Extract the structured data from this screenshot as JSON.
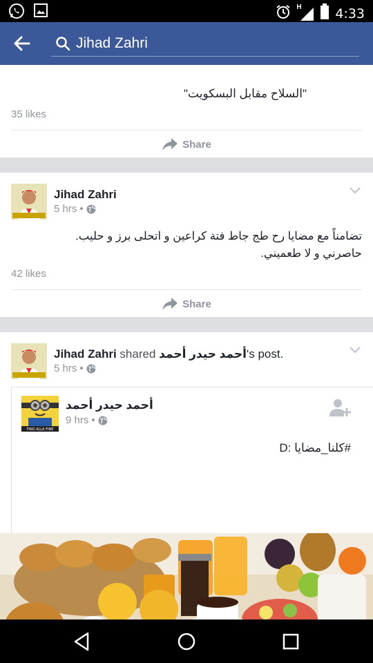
{
  "status_bar": {
    "time": "4:33",
    "network_label": "H"
  },
  "search": {
    "query": "Jihad Zahri"
  },
  "posts": [
    {
      "text_fragment": "السلاح مقابل البسكويت",
      "likes": "35 likes",
      "share_label": "Share"
    },
    {
      "author": "Jihad Zahri",
      "time": "5 hrs",
      "separator": "•",
      "body_line1": "تضامناً مع مضايا رح طج جاط فتة كراعين و اتحلى برز و حليب.",
      "body_line2": "حاصرني و لا طعميني.",
      "likes": "42 likes",
      "share_label": "Share"
    },
    {
      "author": "Jihad Zahri",
      "shared_word": "shared",
      "shared_name": "أحمد حيدر أحمد",
      "post_suffix": "'s post.",
      "time": "5 hrs",
      "separator": "•",
      "inner": {
        "author": "أحمد حيدر أحمد",
        "time": "9 hrs",
        "separator": "•",
        "text": "#كلنا_مضايا :D"
      }
    }
  ],
  "icons": {
    "whatsapp": "whatsapp-icon",
    "gallery": "image-icon",
    "alarm": "alarm-icon",
    "signal": "signal-icon",
    "battery": "battery-icon",
    "back": "back-arrow-icon",
    "search": "search-icon",
    "share": "share-icon",
    "globe": "globe-icon",
    "chevron": "chevron-down-icon",
    "add_friend": "add-friend-icon",
    "nav_back": "nav-back-icon",
    "nav_home": "nav-home-icon",
    "nav_recents": "nav-recents-icon"
  },
  "colors": {
    "brand": "#3b5998",
    "feed_bg": "#dddfe2",
    "muted": "#90949c"
  }
}
